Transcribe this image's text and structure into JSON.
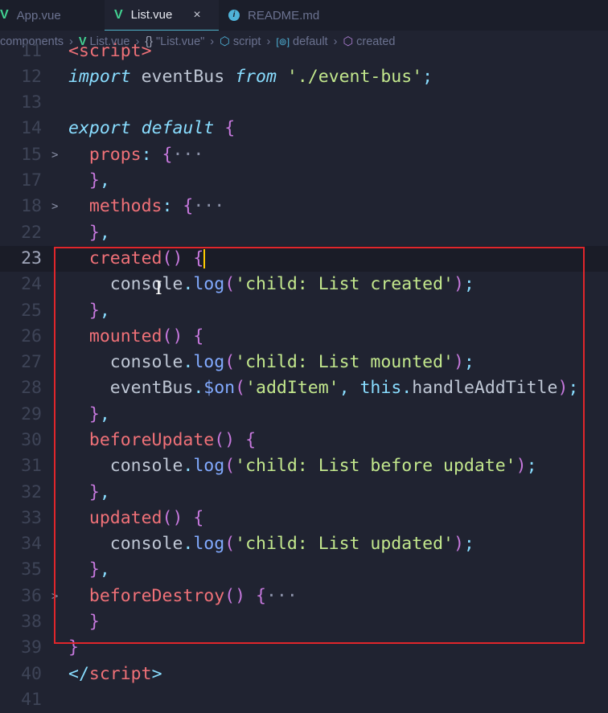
{
  "tabs": [
    {
      "label": "App.vue",
      "icon": "vue-icon",
      "active": false
    },
    {
      "label": "List.vue",
      "icon": "vue-icon",
      "active": true,
      "close": "×"
    },
    {
      "label": "README.md",
      "icon": "info-icon",
      "active": false
    }
  ],
  "breadcrumb": [
    "components",
    "List.vue",
    "\"List.vue\"",
    "script",
    "default",
    "created"
  ],
  "colors": {
    "background": "#202331",
    "highlight_box": "#e0262b",
    "keyword": "#89ddff",
    "string": "#c3e88d",
    "method_name": "#f07178",
    "brace": "#c678dd"
  },
  "lines": [
    {
      "n": "11",
      "fold": "",
      "tokens": [
        [
          "<script>",
          "tag"
        ]
      ]
    },
    {
      "n": "12",
      "fold": "",
      "tokens": [
        [
          "import",
          "kw"
        ],
        [
          " eventBus ",
          "id"
        ],
        [
          "from",
          "kw"
        ],
        [
          " ",
          "id"
        ],
        [
          "'./event-bus'",
          "str"
        ],
        [
          ";",
          "pun"
        ]
      ]
    },
    {
      "n": "13",
      "fold": "",
      "tokens": []
    },
    {
      "n": "14",
      "fold": "",
      "tokens": [
        [
          "export",
          "kw"
        ],
        [
          " ",
          "id"
        ],
        [
          "default",
          "kw"
        ],
        [
          " ",
          "id"
        ],
        [
          "{",
          "br"
        ]
      ]
    },
    {
      "n": "15",
      "fold": ">",
      "tokens": [
        [
          "  ",
          "id"
        ],
        [
          "props",
          "prop"
        ],
        [
          ": ",
          "pun"
        ],
        [
          "{",
          "br"
        ],
        [
          "···",
          "dots"
        ]
      ]
    },
    {
      "n": "17",
      "fold": "",
      "tokens": [
        [
          "  ",
          "id"
        ],
        [
          "}",
          "br"
        ],
        [
          ",",
          "pun"
        ]
      ]
    },
    {
      "n": "18",
      "fold": ">",
      "tokens": [
        [
          "  ",
          "id"
        ],
        [
          "methods",
          "prop"
        ],
        [
          ": ",
          "pun"
        ],
        [
          "{",
          "br"
        ],
        [
          "···",
          "dots"
        ]
      ]
    },
    {
      "n": "22",
      "fold": "",
      "tokens": [
        [
          "  ",
          "id"
        ],
        [
          "}",
          "br"
        ],
        [
          ",",
          "pun"
        ]
      ]
    },
    {
      "n": "23",
      "fold": "",
      "current": true,
      "tokens": [
        [
          "  ",
          "id"
        ],
        [
          "created",
          "fn"
        ],
        [
          "()",
          "br"
        ],
        [
          " ",
          "id"
        ],
        [
          "{",
          "br"
        ]
      ]
    },
    {
      "n": "24",
      "fold": "",
      "tokens": [
        [
          "    console",
          "id"
        ],
        [
          ".",
          "pun"
        ],
        [
          "log",
          "meth"
        ],
        [
          "(",
          "br"
        ],
        [
          "'child: List created'",
          "str"
        ],
        [
          ")",
          "br"
        ],
        [
          ";",
          "pun"
        ]
      ]
    },
    {
      "n": "25",
      "fold": "",
      "tokens": [
        [
          "  ",
          "id"
        ],
        [
          "}",
          "br"
        ],
        [
          ",",
          "pun"
        ]
      ]
    },
    {
      "n": "26",
      "fold": "",
      "tokens": [
        [
          "  ",
          "id"
        ],
        [
          "mounted",
          "fn"
        ],
        [
          "()",
          "br"
        ],
        [
          " ",
          "id"
        ],
        [
          "{",
          "br"
        ]
      ]
    },
    {
      "n": "27",
      "fold": "",
      "tokens": [
        [
          "    console",
          "id"
        ],
        [
          ".",
          "pun"
        ],
        [
          "log",
          "meth"
        ],
        [
          "(",
          "br"
        ],
        [
          "'child: List mounted'",
          "str"
        ],
        [
          ")",
          "br"
        ],
        [
          ";",
          "pun"
        ]
      ]
    },
    {
      "n": "28",
      "fold": "",
      "tokens": [
        [
          "    eventBus",
          "id"
        ],
        [
          ".",
          "pun"
        ],
        [
          "$on",
          "meth"
        ],
        [
          "(",
          "br"
        ],
        [
          "'addItem'",
          "str"
        ],
        [
          ", ",
          "pun"
        ],
        [
          "this",
          "this"
        ],
        [
          ".",
          "pun"
        ],
        [
          "handleAddTitle",
          "id"
        ],
        [
          ")",
          "br"
        ],
        [
          ";",
          "pun"
        ]
      ]
    },
    {
      "n": "29",
      "fold": "",
      "tokens": [
        [
          "  ",
          "id"
        ],
        [
          "}",
          "br"
        ],
        [
          ",",
          "pun"
        ]
      ]
    },
    {
      "n": "30",
      "fold": "",
      "tokens": [
        [
          "  ",
          "id"
        ],
        [
          "beforeUpdate",
          "fn"
        ],
        [
          "()",
          "br"
        ],
        [
          " ",
          "id"
        ],
        [
          "{",
          "br"
        ]
      ]
    },
    {
      "n": "31",
      "fold": "",
      "tokens": [
        [
          "    console",
          "id"
        ],
        [
          ".",
          "pun"
        ],
        [
          "log",
          "meth"
        ],
        [
          "(",
          "br"
        ],
        [
          "'child: List before update'",
          "str"
        ],
        [
          ")",
          "br"
        ],
        [
          ";",
          "pun"
        ]
      ]
    },
    {
      "n": "32",
      "fold": "",
      "tokens": [
        [
          "  ",
          "id"
        ],
        [
          "}",
          "br"
        ],
        [
          ",",
          "pun"
        ]
      ]
    },
    {
      "n": "33",
      "fold": "",
      "tokens": [
        [
          "  ",
          "id"
        ],
        [
          "updated",
          "fn"
        ],
        [
          "()",
          "br"
        ],
        [
          " ",
          "id"
        ],
        [
          "{",
          "br"
        ]
      ]
    },
    {
      "n": "34",
      "fold": "",
      "tokens": [
        [
          "    console",
          "id"
        ],
        [
          ".",
          "pun"
        ],
        [
          "log",
          "meth"
        ],
        [
          "(",
          "br"
        ],
        [
          "'child: List updated'",
          "str"
        ],
        [
          ")",
          "br"
        ],
        [
          ";",
          "pun"
        ]
      ]
    },
    {
      "n": "35",
      "fold": "",
      "tokens": [
        [
          "  ",
          "id"
        ],
        [
          "}",
          "br"
        ],
        [
          ",",
          "pun"
        ]
      ]
    },
    {
      "n": "36",
      "fold": ">",
      "tokens": [
        [
          "  ",
          "id"
        ],
        [
          "beforeDestroy",
          "fn"
        ],
        [
          "()",
          "br"
        ],
        [
          " ",
          "id"
        ],
        [
          "{",
          "br"
        ],
        [
          "···",
          "dots"
        ]
      ]
    },
    {
      "n": "38",
      "fold": "",
      "tokens": [
        [
          "  ",
          "id"
        ],
        [
          "}",
          "br"
        ]
      ]
    },
    {
      "n": "39",
      "fold": "",
      "tokens": [
        [
          "}",
          "br"
        ]
      ]
    },
    {
      "n": "40",
      "fold": "",
      "tokens": [
        [
          "</",
          "pun"
        ],
        [
          "script",
          "tag"
        ],
        [
          ">",
          "pun"
        ]
      ]
    },
    {
      "n": "41",
      "fold": "",
      "tokens": []
    }
  ]
}
